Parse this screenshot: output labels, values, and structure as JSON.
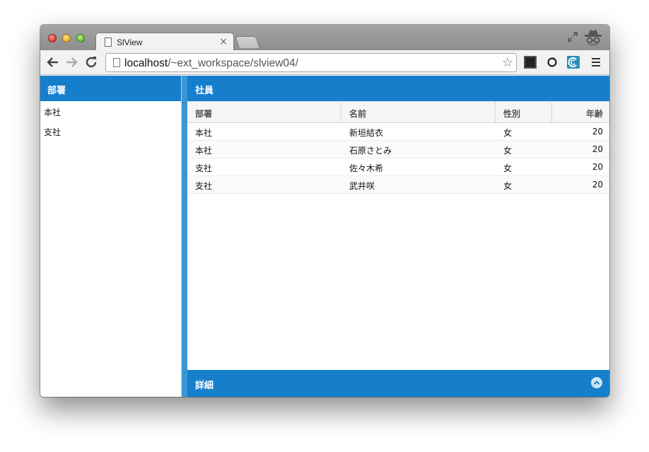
{
  "browser": {
    "tab_title": "SlView",
    "tab_close": "×",
    "url_host": "localhost",
    "url_path": "/~ext_workspace/slview04/",
    "icons": [
      "back-arrow-icon",
      "forward-arrow-icon",
      "reload-icon",
      "page-icon",
      "star-icon",
      "terminal-icon",
      "sync-icon",
      "extension-icon",
      "menu-icon",
      "incognito-icon",
      "fullscreen-icon"
    ]
  },
  "west": {
    "title": "部署",
    "items": [
      {
        "label": "本社"
      },
      {
        "label": "支社"
      }
    ]
  },
  "center": {
    "title": "社員",
    "columns": [
      "部署",
      "名前",
      "性別",
      "年齢"
    ],
    "rows": [
      {
        "dept": "本社",
        "name": "新垣結衣",
        "gender": "女",
        "age": "20"
      },
      {
        "dept": "本社",
        "name": "石原さとみ",
        "gender": "女",
        "age": "20"
      },
      {
        "dept": "支社",
        "name": "佐々木希",
        "gender": "女",
        "age": "20"
      },
      {
        "dept": "支社",
        "name": "武井咲",
        "gender": "女",
        "age": "20"
      }
    ]
  },
  "south": {
    "title": "詳細"
  },
  "colors": {
    "header_blue": "#157fcc",
    "splitter_blue": "#3a96d6"
  }
}
